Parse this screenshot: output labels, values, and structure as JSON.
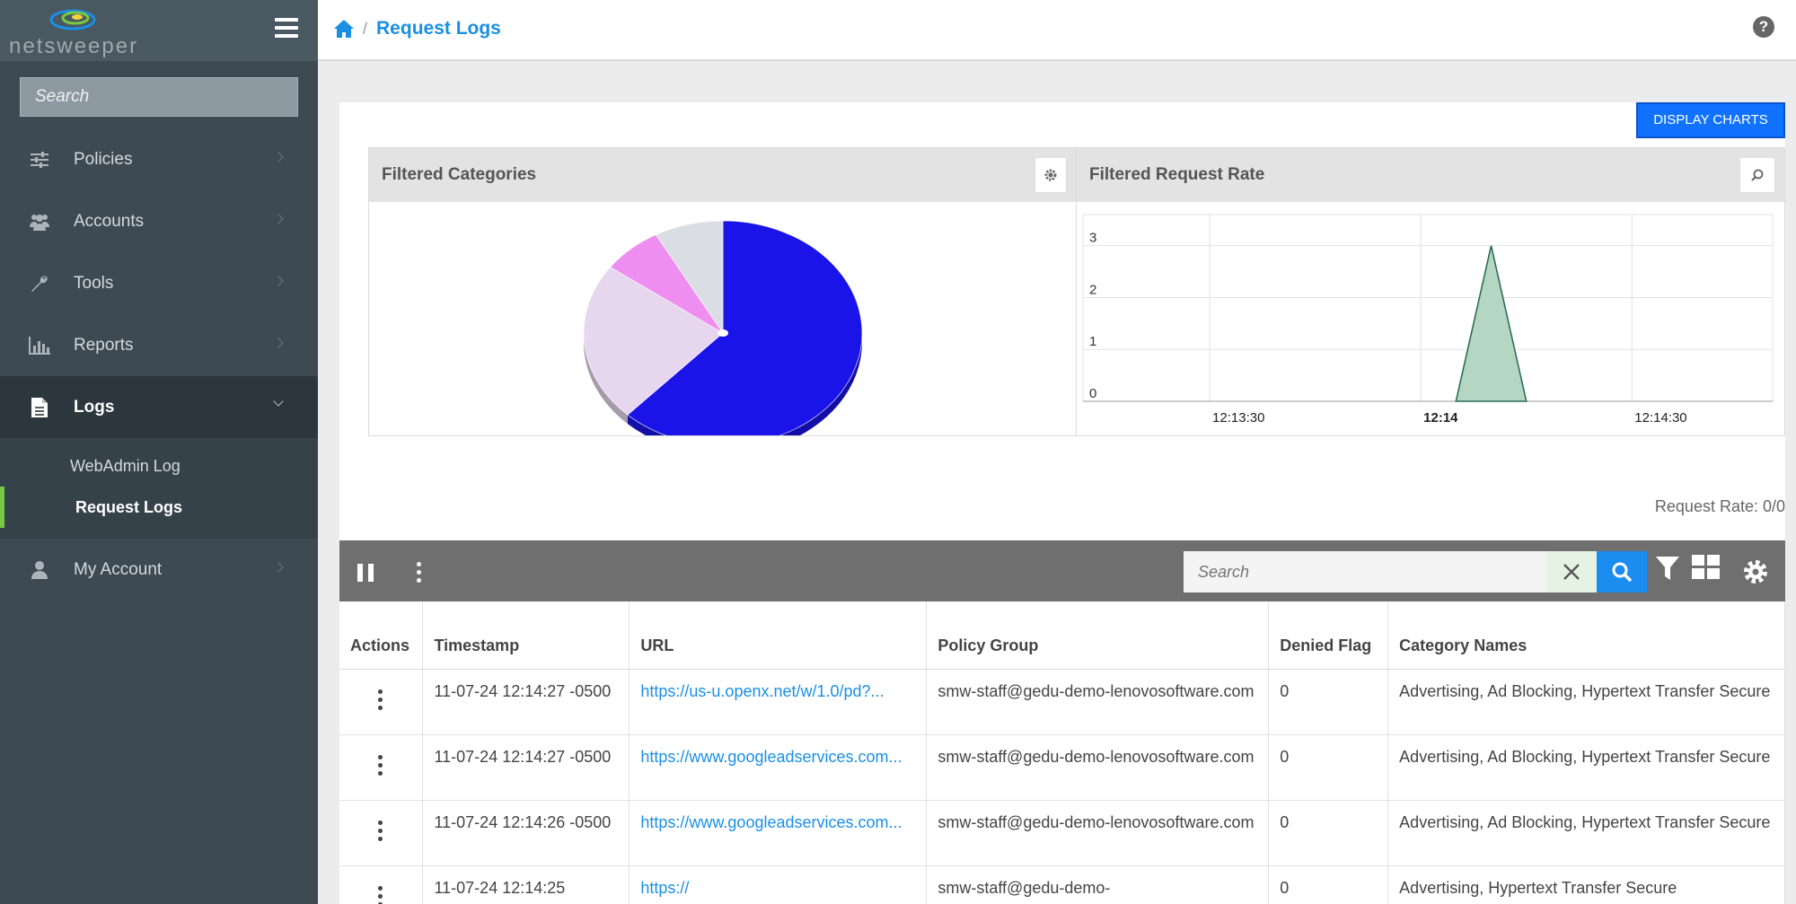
{
  "brand": {
    "name": "netsweeper"
  },
  "sidebar": {
    "search_placeholder": "Search",
    "items": [
      {
        "label": "Policies",
        "icon": "sliders-icon"
      },
      {
        "label": "Accounts",
        "icon": "users-icon"
      },
      {
        "label": "Tools",
        "icon": "wrench-icon"
      },
      {
        "label": "Reports",
        "icon": "bar-chart-icon"
      },
      {
        "label": "Logs",
        "icon": "document-icon",
        "active": true
      },
      {
        "label": "My Account",
        "icon": "user-icon"
      }
    ],
    "sub_items": [
      {
        "label": "WebAdmin Log"
      },
      {
        "label": "Request Logs",
        "active": true
      }
    ]
  },
  "header": {
    "breadcrumb": "Request Logs"
  },
  "main": {
    "display_charts_label": "DISPLAY CHARTS",
    "categories_title": "Filtered Categories",
    "rate_title": "Filtered Request Rate",
    "request_rate": "Request Rate: 0/0",
    "search_placeholder": "Search"
  },
  "chart_data": [
    {
      "type": "pie",
      "title": "Filtered Categories",
      "values": [
        62,
        23,
        7,
        8
      ],
      "colors": [
        "#1a14e8",
        "#e6d7ee",
        "#ee8ef0",
        "#dadde3"
      ]
    },
    {
      "type": "area",
      "title": "Filtered Request Rate",
      "x": [
        "12:13:30",
        "12:14",
        "12:14:30"
      ],
      "ylim": [
        0,
        3.6
      ],
      "yticks": [
        0,
        1,
        2,
        3
      ],
      "points": [
        {
          "t": "12:14:05",
          "v": 0
        },
        {
          "t": "12:14:10",
          "v": 3
        },
        {
          "t": "12:14:15",
          "v": 0
        }
      ],
      "color": "#b5d6c2"
    }
  ],
  "table": {
    "columns": [
      "Actions",
      "Timestamp",
      "URL",
      "Policy Group",
      "Denied Flag",
      "Category Names"
    ],
    "rows": [
      {
        "timestamp": "11-07-24 12:14:27 -0500",
        "url": "https://us-u.openx.net/w/1.0/pd?...",
        "policy": "smw-staff@gedu-demo-lenovosoftware.com",
        "denied": "0",
        "categories": "Advertising, Ad Blocking, Hypertext Transfer Secure"
      },
      {
        "timestamp": "11-07-24 12:14:27 -0500",
        "url": "https://www.googleadservices.com...",
        "policy": "smw-staff@gedu-demo-lenovosoftware.com",
        "denied": "0",
        "categories": "Advertising, Ad Blocking, Hypertext Transfer Secure"
      },
      {
        "timestamp": "11-07-24 12:14:26 -0500",
        "url": "https://www.googleadservices.com...",
        "policy": "smw-staff@gedu-demo-lenovosoftware.com",
        "denied": "0",
        "categories": "Advertising, Ad Blocking, Hypertext Transfer Secure"
      },
      {
        "timestamp": "11-07-24 12:14:25",
        "url": "https://",
        "policy": "smw-staff@gedu-demo-",
        "denied": "0",
        "categories": "Advertising, Hypertext Transfer Secure"
      }
    ]
  }
}
